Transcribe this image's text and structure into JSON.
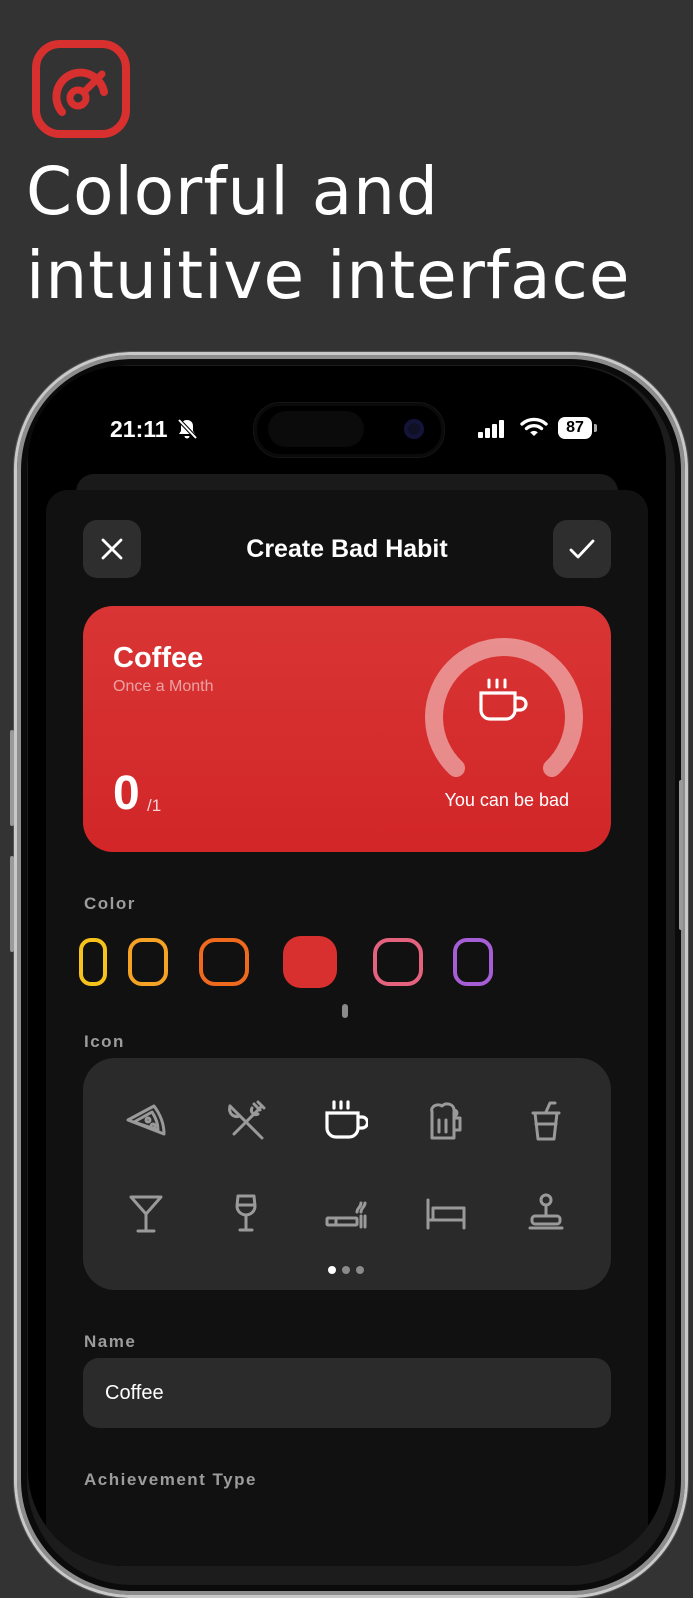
{
  "promo": {
    "headline_line1": "Colorful and",
    "headline_line2": "intuitive interface",
    "logo_icon": "gauge-icon",
    "accent": "#d8302f"
  },
  "status_bar": {
    "time": "21:11",
    "battery": "87",
    "icons": [
      "bell-slash-icon",
      "signal-icon",
      "wifi-icon",
      "battery-icon"
    ]
  },
  "nav": {
    "title": "Create Bad Habit",
    "close_icon": "close-icon",
    "confirm_icon": "checkmark-icon"
  },
  "preview": {
    "name": "Coffee",
    "frequency": "Once a Month",
    "count": "0",
    "goal": "/1",
    "status": "You can be bad",
    "icon": "coffee-cup-icon",
    "color": "#d8302f"
  },
  "color_section": {
    "label": "Color",
    "swatches": [
      "#f7c21c",
      "#f5a225",
      "#f06a1e",
      "#d8302f",
      "#e5627f",
      "#a65ed6"
    ],
    "selected_index": 3
  },
  "icon_section": {
    "label": "Icon",
    "icons": [
      "pizza-icon",
      "fork-knife-icon",
      "coffee-cup-icon",
      "beer-mug-icon",
      "soda-cup-icon",
      "cocktail-icon",
      "wine-glass-icon",
      "cigarette-icon",
      "bed-icon",
      "joystick-icon"
    ],
    "selected_icon": "coffee-cup-icon",
    "pages": 3,
    "current_page": 1
  },
  "name_section": {
    "label": "Name",
    "value": "Coffee"
  },
  "achievement_section": {
    "label": "Achievement Type"
  }
}
